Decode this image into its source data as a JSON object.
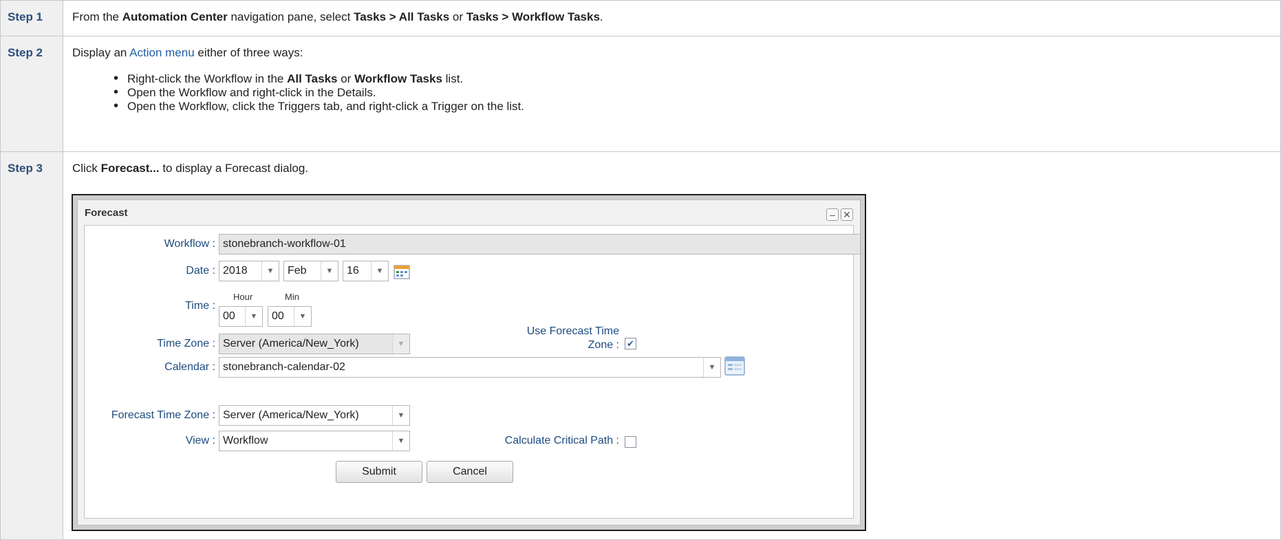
{
  "steps": [
    {
      "label": "Step 1",
      "text": {
        "t1": "From the ",
        "b1": "Automation Center",
        "t2": " navigation pane, select ",
        "b2": "Tasks > All Tasks",
        "t3": " or ",
        "b3": "Tasks > Workflow Tasks",
        "t4": "."
      }
    },
    {
      "label": "Step 2",
      "intro": {
        "t1": "Display an ",
        "link": "Action menu",
        "t2": " either of three ways:"
      },
      "bullets": {
        "b1": {
          "t1": "Right-click the Workflow in the ",
          "b1": "All Tasks",
          "t2": " or ",
          "b2": "Workflow Tasks",
          "t3": " list."
        },
        "b2": "Open the Workflow and right-click in the Details.",
        "b3": "Open the Workflow, click the Triggers tab, and right-click a Trigger on the list."
      }
    },
    {
      "label": "Step 3",
      "text": {
        "t1": "Click ",
        "b1": "Forecast...",
        "t2": " to display a Forecast dialog."
      }
    }
  ],
  "dialog": {
    "title": "Forecast",
    "minimize_glyph": "–",
    "close_glyph": "✕",
    "workflow": {
      "label": "Workflow :",
      "value": "stonebranch-workflow-01"
    },
    "date": {
      "label": "Date :",
      "year": "2018",
      "month": "Feb",
      "day": "16"
    },
    "time": {
      "label": "Time :",
      "hour_label": "Hour",
      "min_label": "Min",
      "hour": "00",
      "min": "00"
    },
    "time_zone": {
      "label": "Time Zone :",
      "value": "Server (America/New_York)"
    },
    "use_forecast_tz": {
      "label_line1": "Use Forecast Time",
      "label_line2": "Zone :",
      "checked": true
    },
    "calendar": {
      "label": "Calendar :",
      "value": "stonebranch-calendar-02"
    },
    "forecast_time_zone": {
      "label": "Forecast Time Zone :",
      "value": "Server (America/New_York)"
    },
    "view": {
      "label": "View :",
      "value": "Workflow"
    },
    "critical_path": {
      "label": "Calculate Critical Path :",
      "checked": false
    },
    "submit_label": "Submit",
    "cancel_label": "Cancel"
  },
  "icons": {
    "dropdown": "chevron-down-icon",
    "calendar": "calendar-icon",
    "check": "check-icon"
  },
  "colors": {
    "label_blue": "#1d4b80",
    "step_label": "#2b4f7c",
    "link": "#1f5fa6"
  }
}
